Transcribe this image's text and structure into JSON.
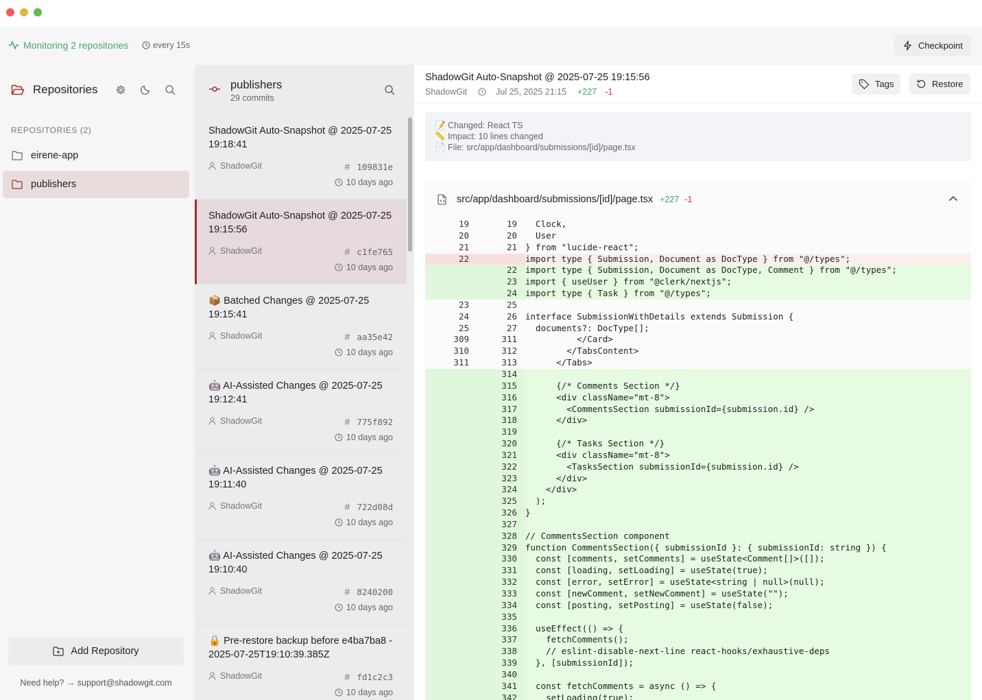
{
  "window": {
    "controls": [
      "close",
      "minimize",
      "zoom"
    ]
  },
  "topbar": {
    "monitoring": "Monitoring 2 repositories",
    "interval": "every 15s",
    "checkpoint_label": "Checkpoint"
  },
  "sidebar": {
    "title": "Repositories",
    "section_label": "REPOSITORIES (2)",
    "repos": [
      {
        "name": "eirene-app",
        "active": false
      },
      {
        "name": "publishers",
        "active": true
      }
    ],
    "add_label": "Add Repository",
    "help": "Need help? → support@shadowgit.com"
  },
  "commits": {
    "repo": "publishers",
    "count": "29 commits",
    "items": [
      {
        "title": "ShadowGit Auto-Snapshot @ 2025-07-25 19:18:41",
        "author": "ShadowGit",
        "hash": "109831e",
        "time": "10 days ago"
      },
      {
        "title": "ShadowGit Auto-Snapshot @ 2025-07-25 19:15:56",
        "author": "ShadowGit",
        "hash": "c1fe765",
        "time": "10 days ago",
        "selected": true
      },
      {
        "title": "📦 Batched Changes @ 2025-07-25 19:15:41",
        "author": "ShadowGit",
        "hash": "aa35e42",
        "time": "10 days ago"
      },
      {
        "title": "🤖 AI-Assisted Changes @ 2025-07-25 19:12:41",
        "author": "ShadowGit",
        "hash": "775f892",
        "time": "10 days ago"
      },
      {
        "title": "🤖 AI-Assisted Changes @ 2025-07-25 19:11:40",
        "author": "ShadowGit",
        "hash": "722d08d",
        "time": "10 days ago"
      },
      {
        "title": "🤖 AI-Assisted Changes @ 2025-07-25 19:10:40",
        "author": "ShadowGit",
        "hash": "8240200",
        "time": "10 days ago"
      },
      {
        "title": "🔒 Pre-restore backup before e4ba7ba8 - 2025-07-25T19:10:39.385Z",
        "author": "ShadowGit",
        "hash": "fd1c2c3",
        "time": "10 days ago"
      }
    ]
  },
  "detail": {
    "title": "ShadowGit Auto-Snapshot @ 2025-07-25 19:15:56",
    "author": "ShadowGit",
    "date": "Jul 25, 2025 21:15",
    "additions": "+227",
    "deletions": "-1",
    "tags_label": "Tags",
    "restore_label": "Restore",
    "summary": [
      "📝 Changed: React TS",
      "📏 Impact: 10 lines changed",
      "📄 File: src/app/dashboard/submissions/[id]/page.tsx"
    ],
    "file": {
      "path": "src/app/dashboard/submissions/[id]/page.tsx",
      "additions": "+227",
      "deletions": "-1"
    },
    "diff": [
      {
        "t": "ctx",
        "o": "19",
        "n": "19",
        "c": "  Clock,"
      },
      {
        "t": "ctx",
        "o": "20",
        "n": "20",
        "c": "  User"
      },
      {
        "t": "ctx",
        "o": "21",
        "n": "21",
        "c": "} from \"lucide-react\";"
      },
      {
        "t": "del",
        "o": "22",
        "n": "",
        "c": "import type { Submission, Document as DocType } from \"@/types\";"
      },
      {
        "t": "add",
        "o": "",
        "n": "22",
        "c": "import type { Submission, Document as DocType, Comment } from \"@/types\";"
      },
      {
        "t": "add",
        "o": "",
        "n": "23",
        "c": "import { useUser } from \"@clerk/nextjs\";"
      },
      {
        "t": "add",
        "o": "",
        "n": "24",
        "c": "import type { Task } from \"@/types\";"
      },
      {
        "t": "ctx",
        "o": "23",
        "n": "25",
        "c": ""
      },
      {
        "t": "ctx",
        "o": "24",
        "n": "26",
        "c": "interface SubmissionWithDetails extends Submission {"
      },
      {
        "t": "ctx",
        "o": "25",
        "n": "27",
        "c": "  documents?: DocType[];"
      },
      {
        "t": "ctx",
        "o": "309",
        "n": "311",
        "c": "          </Card>"
      },
      {
        "t": "ctx",
        "o": "310",
        "n": "312",
        "c": "        </TabsContent>"
      },
      {
        "t": "ctx",
        "o": "311",
        "n": "313",
        "c": "      </Tabs>"
      },
      {
        "t": "add",
        "o": "",
        "n": "314",
        "c": ""
      },
      {
        "t": "add",
        "o": "",
        "n": "315",
        "c": "      {/* Comments Section */}"
      },
      {
        "t": "add",
        "o": "",
        "n": "316",
        "c": "      <div className=\"mt-8\">"
      },
      {
        "t": "add",
        "o": "",
        "n": "317",
        "c": "        <CommentsSection submissionId={submission.id} />"
      },
      {
        "t": "add",
        "o": "",
        "n": "318",
        "c": "      </div>"
      },
      {
        "t": "add",
        "o": "",
        "n": "319",
        "c": ""
      },
      {
        "t": "add",
        "o": "",
        "n": "320",
        "c": "      {/* Tasks Section */}"
      },
      {
        "t": "add",
        "o": "",
        "n": "321",
        "c": "      <div className=\"mt-8\">"
      },
      {
        "t": "add",
        "o": "",
        "n": "322",
        "c": "        <TasksSection submissionId={submission.id} />"
      },
      {
        "t": "add",
        "o": "",
        "n": "323",
        "c": "      </div>"
      },
      {
        "t": "add",
        "o": "",
        "n": "324",
        "c": "    </div>"
      },
      {
        "t": "add",
        "o": "",
        "n": "325",
        "c": "  );"
      },
      {
        "t": "add",
        "o": "",
        "n": "326",
        "c": "}"
      },
      {
        "t": "add",
        "o": "",
        "n": "327",
        "c": ""
      },
      {
        "t": "add",
        "o": "",
        "n": "328",
        "c": "// CommentsSection component"
      },
      {
        "t": "add",
        "o": "",
        "n": "329",
        "c": "function CommentsSection({ submissionId }: { submissionId: string }) {"
      },
      {
        "t": "add",
        "o": "",
        "n": "330",
        "c": "  const [comments, setComments] = useState<Comment[]>([]);"
      },
      {
        "t": "add",
        "o": "",
        "n": "331",
        "c": "  const [loading, setLoading] = useState(true);"
      },
      {
        "t": "add",
        "o": "",
        "n": "332",
        "c": "  const [error, setError] = useState<string | null>(null);"
      },
      {
        "t": "add",
        "o": "",
        "n": "333",
        "c": "  const [newComment, setNewComment] = useState(\"\");"
      },
      {
        "t": "add",
        "o": "",
        "n": "334",
        "c": "  const [posting, setPosting] = useState(false);"
      },
      {
        "t": "add",
        "o": "",
        "n": "335",
        "c": ""
      },
      {
        "t": "add",
        "o": "",
        "n": "336",
        "c": "  useEffect(() => {"
      },
      {
        "t": "add",
        "o": "",
        "n": "337",
        "c": "    fetchComments();"
      },
      {
        "t": "add",
        "o": "",
        "n": "338",
        "c": "    // eslint-disable-next-line react-hooks/exhaustive-deps"
      },
      {
        "t": "add",
        "o": "",
        "n": "339",
        "c": "  }, [submissionId]);"
      },
      {
        "t": "add",
        "o": "",
        "n": "340",
        "c": ""
      },
      {
        "t": "add",
        "o": "",
        "n": "341",
        "c": "  const fetchComments = async () => {"
      },
      {
        "t": "add",
        "o": "",
        "n": "342",
        "c": "    setLoading(true);"
      }
    ]
  },
  "colors": {
    "accent": "#9e2f2f",
    "add": "#45a263",
    "del": "#c0392b",
    "monitor": "#4fa36e"
  }
}
